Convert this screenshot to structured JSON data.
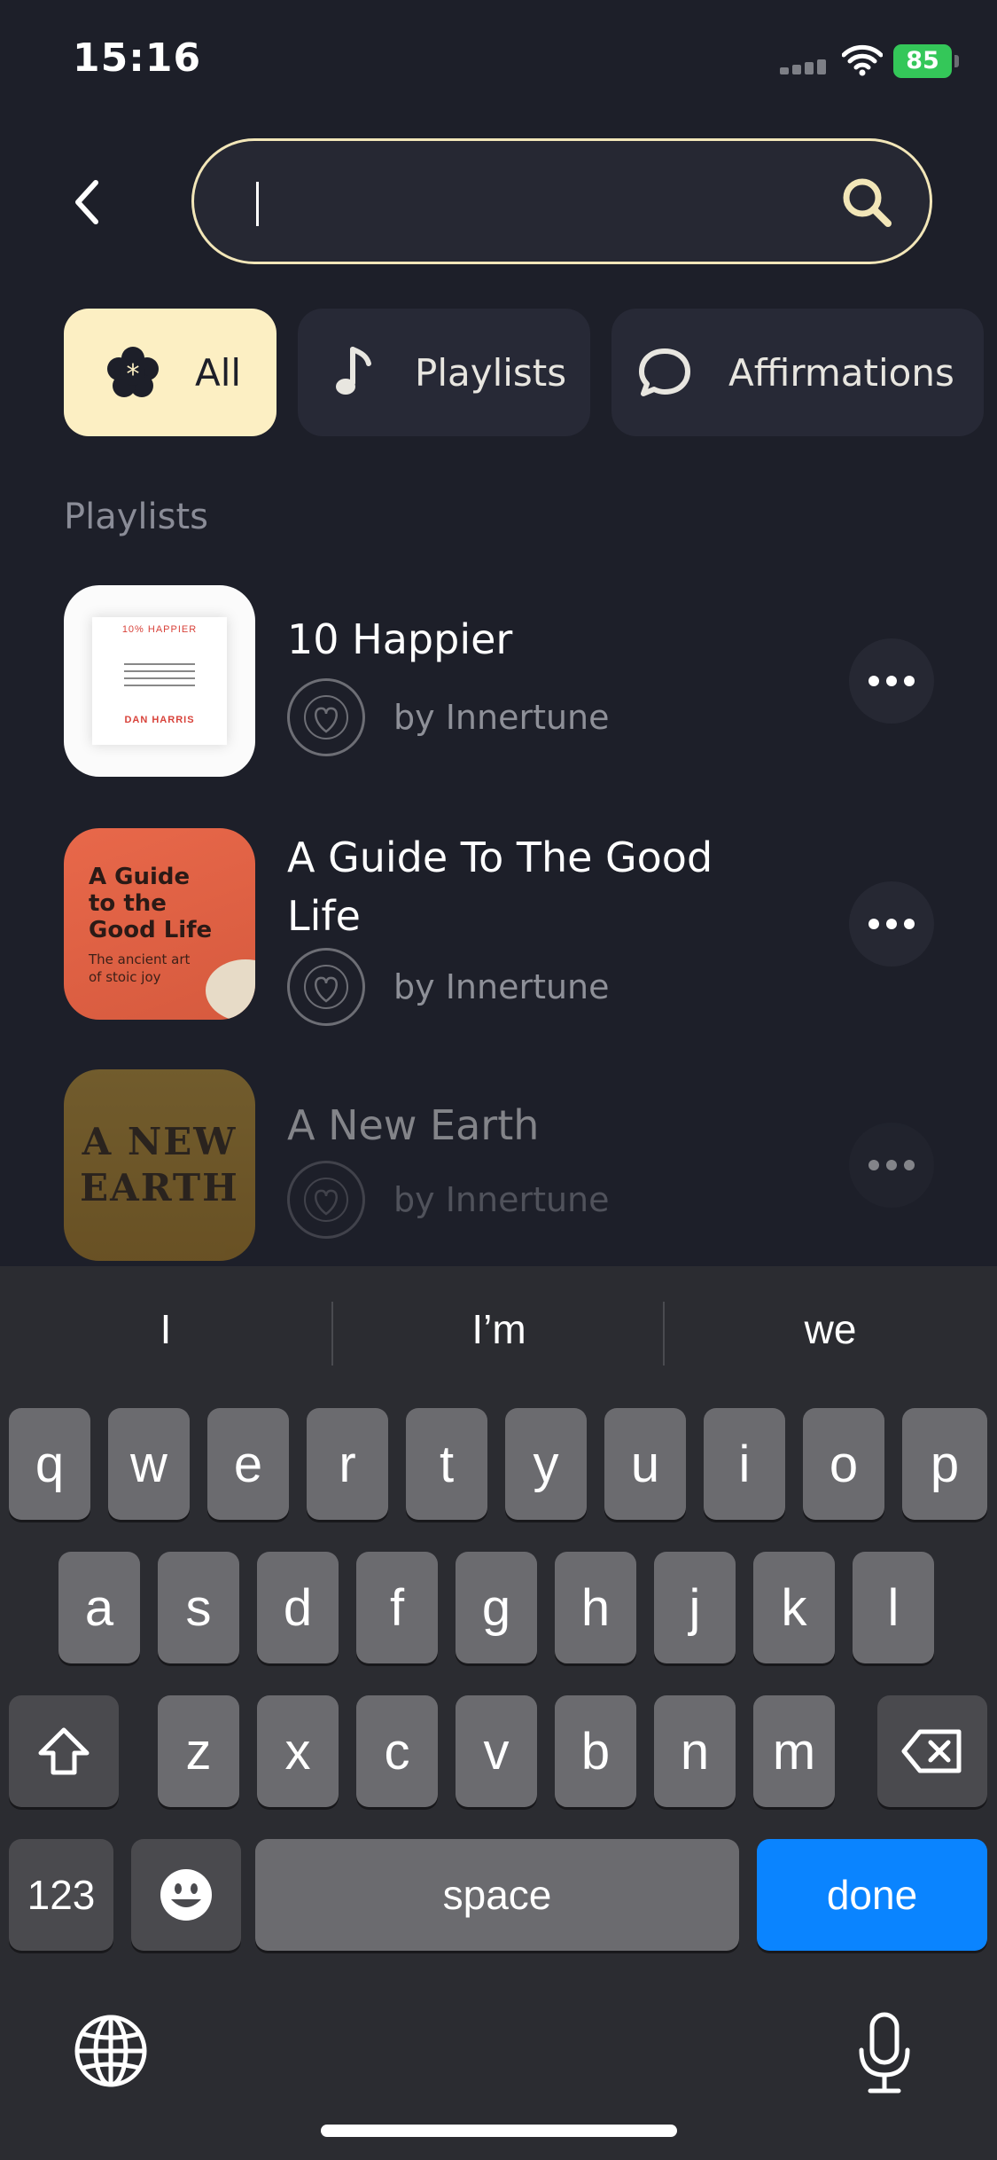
{
  "status_bar": {
    "time": "15:16",
    "battery": "85",
    "battery_color": "#34c759"
  },
  "search": {
    "value": "",
    "placeholder": "",
    "accent": "#f2e6b8"
  },
  "filters": [
    {
      "label": "All",
      "icon": "flower-star-icon",
      "active": true
    },
    {
      "label": "Playlists",
      "icon": "music-note-icon",
      "active": false
    },
    {
      "label": "Affirmations",
      "icon": "speech-bubble-icon",
      "active": false
    }
  ],
  "section": {
    "title": "Playlists"
  },
  "playlists": [
    {
      "title": "10 Happier",
      "author": "by Innertune",
      "cover": {
        "top": "10% HAPPIER",
        "bottom": "DAN HARRIS"
      }
    },
    {
      "title": "A Guide To The Good Life",
      "author": "by Innertune",
      "cover": {
        "top": "A Guide to the Good Life",
        "bottom": "The ancient art of stoic joy"
      }
    },
    {
      "title": "A New Earth",
      "author": "by Innertune",
      "cover": {
        "top": "A NEW EARTH",
        "bottom": ""
      }
    }
  ],
  "keyboard": {
    "suggestions": [
      "I",
      "I’m",
      "we"
    ],
    "row1": [
      "q",
      "w",
      "e",
      "r",
      "t",
      "y",
      "u",
      "i",
      "o",
      "p"
    ],
    "row2": [
      "a",
      "s",
      "d",
      "f",
      "g",
      "h",
      "j",
      "k",
      "l"
    ],
    "row3": [
      "z",
      "x",
      "c",
      "v",
      "b",
      "n",
      "m"
    ],
    "numbers_label": "123",
    "space_label": "space",
    "done_label": "done",
    "done_color": "#0a84ff"
  }
}
